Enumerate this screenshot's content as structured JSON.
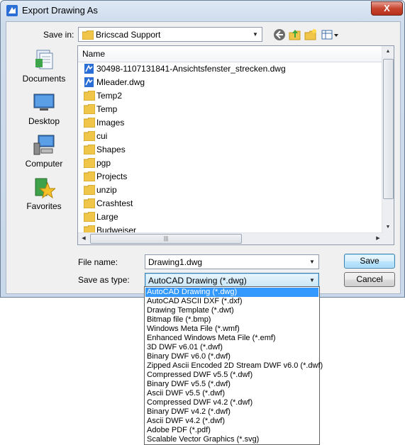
{
  "window": {
    "title": "Export Drawing As",
    "close_label": "X"
  },
  "save_in": {
    "label": "Save in:",
    "value": "Bricscad Support"
  },
  "toolbar": {
    "icons": [
      "back-icon",
      "up-folder-icon",
      "new-folder-icon",
      "views-menu-icon"
    ]
  },
  "places": [
    {
      "label": "Documents",
      "icon": "documents-icon"
    },
    {
      "label": "Desktop",
      "icon": "desktop-icon"
    },
    {
      "label": "Computer",
      "icon": "computer-icon"
    },
    {
      "label": "Favorites",
      "icon": "favorites-icon"
    }
  ],
  "file_list": {
    "column_header": "Name",
    "items": [
      {
        "name": "30498-1107131841-Ansichtsfenster_strecken.dwg",
        "type": "dwg"
      },
      {
        "name": "Mleader.dwg",
        "type": "dwg"
      },
      {
        "name": "Temp2",
        "type": "folder"
      },
      {
        "name": "Temp",
        "type": "folder"
      },
      {
        "name": "Images",
        "type": "folder"
      },
      {
        "name": "cui",
        "type": "folder"
      },
      {
        "name": "Shapes",
        "type": "folder"
      },
      {
        "name": "pgp",
        "type": "folder"
      },
      {
        "name": "Projects",
        "type": "folder"
      },
      {
        "name": "unzip",
        "type": "folder"
      },
      {
        "name": "Crashtest",
        "type": "folder"
      },
      {
        "name": "Large",
        "type": "folder"
      },
      {
        "name": "Budweiser",
        "type": "folder"
      }
    ]
  },
  "file_name": {
    "label": "File name:",
    "value": "Drawing1.dwg"
  },
  "save_as_type": {
    "label": "Save as type:",
    "value": "AutoCAD Drawing (*.dwg)",
    "options": [
      "AutoCAD Drawing (*.dwg)",
      "AutoCAD ASCII DXF (*.dxf)",
      "Drawing Template (*.dwt)",
      "Bitmap file (*.bmp)",
      "Windows Meta File (*.wmf)",
      "Enhanced Windows Meta File (*.emf)",
      "3D DWF v6.01 (*.dwf)",
      "Binary DWF v6.0 (*.dwf)",
      "Zipped Ascii Encoded 2D Stream DWF v6.0 (*.dwf)",
      "Compressed DWF v5.5 (*.dwf)",
      "Binary DWF v5.5 (*.dwf)",
      "Ascii DWF v5.5 (*.dwf)",
      "Compressed DWF v4.2 (*.dwf)",
      "Binary DWF v4.2 (*.dwf)",
      "Ascii DWF v4.2 (*.dwf)",
      "Adobe PDF (*.pdf)",
      "Scalable Vector Graphics (*.svg)"
    ],
    "selected_index": 0
  },
  "buttons": {
    "save": "Save",
    "cancel": "Cancel"
  },
  "colors": {
    "selection": "#3399ff",
    "folder": "#f0c64a",
    "dwg_icon": "#2b6fd6"
  }
}
